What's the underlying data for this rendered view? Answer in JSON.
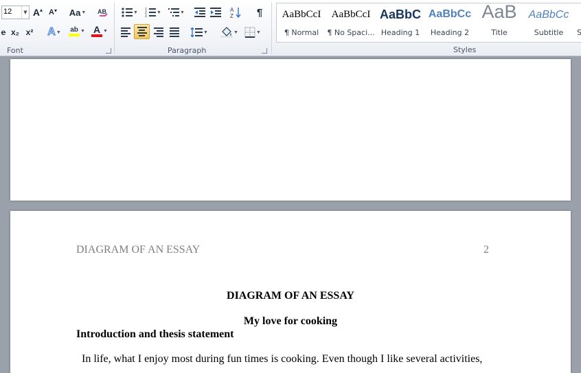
{
  "ribbon": {
    "font_group": {
      "label": "Font",
      "font_size": "12",
      "grow_font": "A",
      "shrink_font": "A",
      "change_case": "Aa",
      "strikethrough": "e",
      "subscript": "x₂",
      "superscript": "x²",
      "text_effects": "A",
      "highlight": "ab",
      "font_color": "A"
    },
    "paragraph_group": {
      "label": "Paragraph",
      "pilcrow": "¶"
    },
    "styles_group": {
      "label": "Styles",
      "items": [
        {
          "sample": "AaBbCcI",
          "name": "¶ Normal"
        },
        {
          "sample": "AaBbCcI",
          "name": "¶ No Spaci..."
        },
        {
          "sample": "AaBbC",
          "name": "Heading 1"
        },
        {
          "sample": "AaBbCc",
          "name": "Heading 2"
        },
        {
          "sample": "AaB",
          "name": "Title"
        },
        {
          "sample": "AaBbCc",
          "name": "Subtitle"
        },
        {
          "sample": "",
          "name": "S"
        }
      ]
    },
    "colors": {
      "highlight": "#ffff00",
      "font_color": "#e0141e",
      "heading": "#17365d",
      "heading2": "#4f81bd"
    }
  },
  "document": {
    "page2": {
      "header_title": "DIAGRAM OF AN ESSAY",
      "page_number": "2",
      "title": "DIAGRAM OF AN ESSAY",
      "subtitle": "My love for cooking",
      "section_heading": "Introduction and thesis statement",
      "body_line1": "In life, what I enjoy most during fun times is cooking. Even though I like several activities,"
    }
  }
}
